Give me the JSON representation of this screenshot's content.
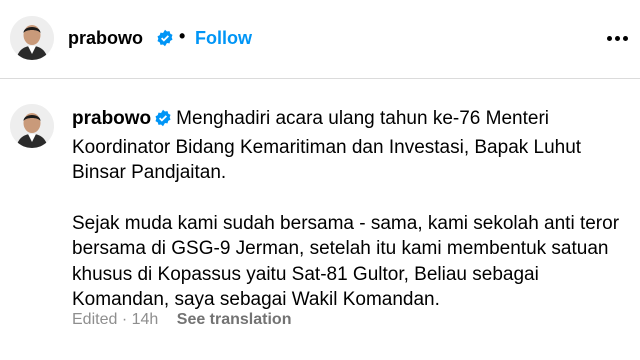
{
  "header": {
    "username": "prabowo",
    "separator": "•",
    "follow_label": "Follow",
    "more_icon": "more-horizontal-icon"
  },
  "post": {
    "username": "prabowo",
    "lines": [
      "Menghadiri acara ulang tahun ke-76 Menteri",
      "Koordinator Bidang Kemaritiman dan Investasi, Bapak Luhut",
      "Binsar Pandjaitan."
    ],
    "paragraph2_lines": [
      "Sejak muda kami sudah bersama - sama, kami sekolah anti teror",
      "bersama di GSG-9 Jerman, setelah itu kami membentuk satuan",
      "khusus di Kopassus yaitu Sat-81 Gultor, Beliau sebagai",
      "Komandan, saya sebagai Wakil Komandan."
    ],
    "edited": "Edited",
    "time_sep": "·",
    "time": "14h",
    "see_translation": "See translation"
  },
  "colors": {
    "accent": "#0095f6",
    "verified": "#0095f6",
    "meta": "#8e8e8e",
    "divider": "#dbdbdb"
  }
}
